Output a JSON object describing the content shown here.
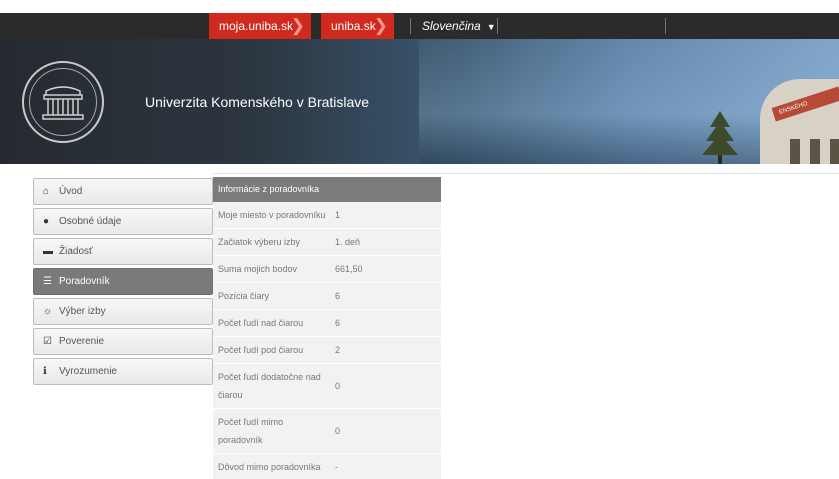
{
  "topbar": {
    "links": [
      "moja.uniba.sk",
      "uniba.sk"
    ],
    "language": "Slovenčina"
  },
  "header": {
    "title": "Univerzita Komenského v Bratislave",
    "building_text": "ENSKÉHO"
  },
  "sidebar": {
    "items": [
      {
        "label": "Úvod",
        "icon": "home-icon",
        "active": false
      },
      {
        "label": "Osobné údaje",
        "icon": "user-icon",
        "active": false
      },
      {
        "label": "Žiadosť",
        "icon": "bed-icon",
        "active": false
      },
      {
        "label": "Poradovník",
        "icon": "list-icon",
        "active": true
      },
      {
        "label": "Výber izby",
        "icon": "lightbulb-icon",
        "active": false
      },
      {
        "label": "Poverenie",
        "icon": "check-square-icon",
        "active": false
      },
      {
        "label": "Vyrozumenie",
        "icon": "info-icon",
        "active": false
      }
    ]
  },
  "info": {
    "heading": "Informácie z poradovníka",
    "rows": [
      {
        "label": "Moje miesto v poradovníku",
        "value": "1"
      },
      {
        "label": "Začiatok výberu izby",
        "value": "1. deň"
      },
      {
        "label": "Suma mojich bodov",
        "value": "661,50"
      },
      {
        "label": "Pozícia čiary",
        "value": "6"
      },
      {
        "label": "Počet ľudí nad čiarou",
        "value": "6"
      },
      {
        "label": "Počet ľudí pod čiarou",
        "value": "2"
      },
      {
        "label": "Počet ľudí dodatočne nad čiarou",
        "value": "0"
      },
      {
        "label": "Počet ľudí mimo poradovník",
        "value": "0"
      },
      {
        "label": "Dôvod mimo poradovníka",
        "value": "-"
      }
    ]
  },
  "colors": {
    "accent": "#d02a1e",
    "topbar": "#2b2b2b",
    "active_nav": "#7a7a7a"
  }
}
